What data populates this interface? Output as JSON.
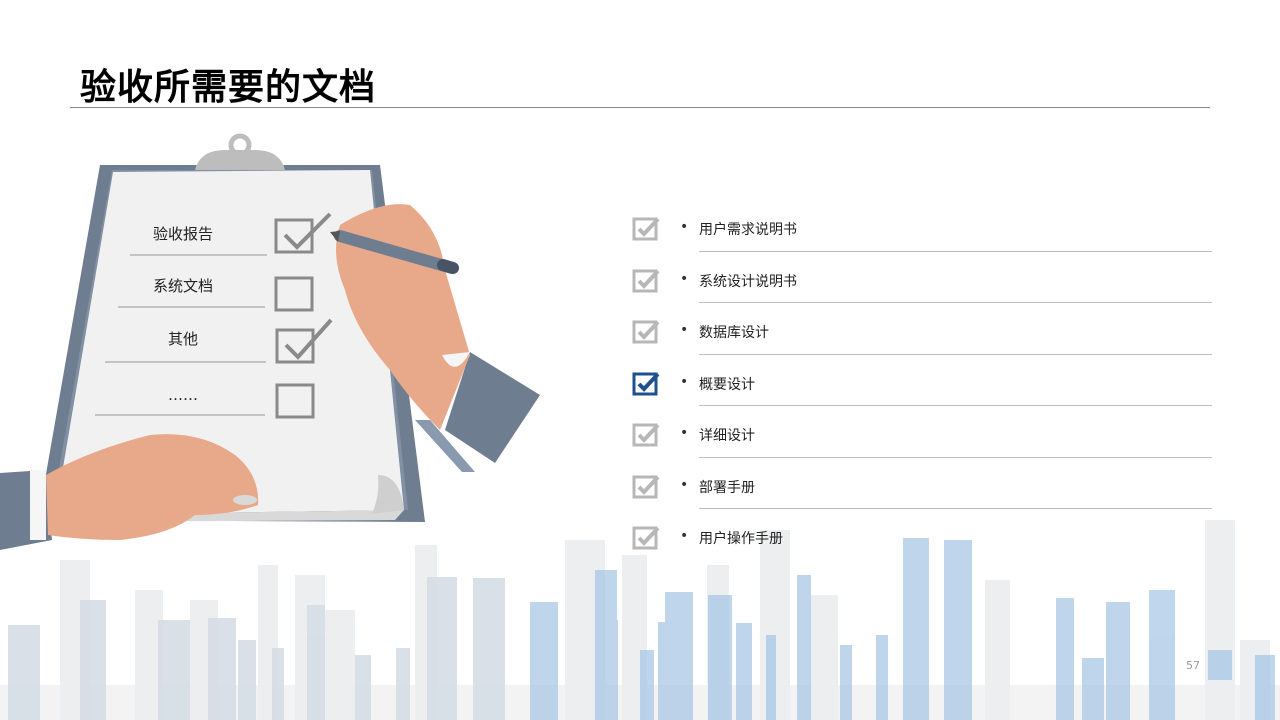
{
  "title": "验收所需要的文档",
  "clipboard": {
    "items": [
      {
        "label": "验收报告",
        "checked": true
      },
      {
        "label": "系统文档",
        "checked": false
      },
      {
        "label": "其他",
        "checked": true
      },
      {
        "label": "……",
        "checked": false
      }
    ]
  },
  "list": {
    "items": [
      {
        "label": "用户需求说明书",
        "style": "gray"
      },
      {
        "label": "系统设计说明书",
        "style": "gray"
      },
      {
        "label": "数据库设计",
        "style": "gray"
      },
      {
        "label": "概要设计",
        "style": "blue"
      },
      {
        "label": "详细设计",
        "style": "gray"
      },
      {
        "label": "部署手册",
        "style": "gray"
      },
      {
        "label": "用户操作手册",
        "style": "gray"
      }
    ]
  },
  "bullet": "•",
  "page_number": "57",
  "colors": {
    "accent": "#1e4f8f",
    "check_gray": "#b7b7b7",
    "skyline_blue": "#a9c8e6",
    "skyline_gray": "#d9dee4"
  }
}
